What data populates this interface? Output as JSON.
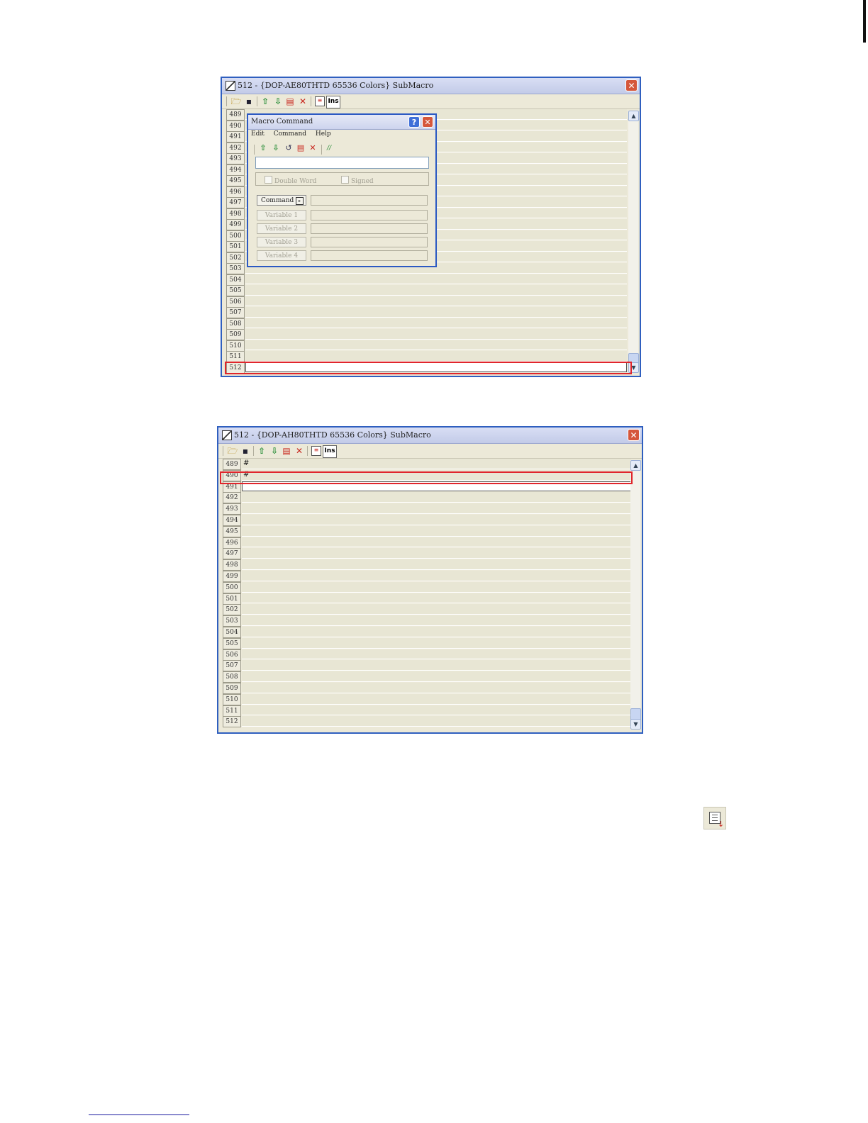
{
  "window1": {
    "title": "512 - {DOP-AE80THTD 65536 Colors} SubMacro",
    "rows": [
      "489",
      "490",
      "491",
      "492",
      "493",
      "494",
      "495",
      "496",
      "497",
      "498",
      "499",
      "500",
      "501",
      "502",
      "503",
      "504",
      "505",
      "506",
      "507",
      "508",
      "509",
      "510",
      "511",
      "512"
    ],
    "selected_row": "512"
  },
  "dialog": {
    "title": "Macro Command",
    "help_glyph": "?",
    "close_glyph": "✕",
    "menu": [
      "Edit",
      "Command",
      "Help"
    ],
    "input_value": "",
    "double_word_label": "Double Word",
    "signed_label": "Signed",
    "command_label": "Command",
    "variable_labels": [
      "Variable 1",
      "Variable 2",
      "Variable 3",
      "Variable 4"
    ],
    "comment_glyph": "//"
  },
  "window2": {
    "title": "512 - {DOP-AH80THTD 65536 Colors} SubMacro",
    "rows": [
      "489",
      "490",
      "491",
      "492",
      "493",
      "494",
      "495",
      "496",
      "497",
      "498",
      "499",
      "500",
      "501",
      "502",
      "503",
      "504",
      "505",
      "506",
      "507",
      "508",
      "509",
      "510",
      "511",
      "512"
    ],
    "row_contents": {
      "489": "#",
      "490": "#"
    },
    "selected_row": "490",
    "editing_row": "491"
  },
  "toolbar": {
    "ins_label": "Ins"
  },
  "icons": [
    "open-icon",
    "save-icon",
    "move-up-icon",
    "move-down-icon",
    "paste-icon",
    "delete-icon",
    "form-icon",
    "insert-icon",
    "scroll-up-icon",
    "scroll-down-icon"
  ]
}
